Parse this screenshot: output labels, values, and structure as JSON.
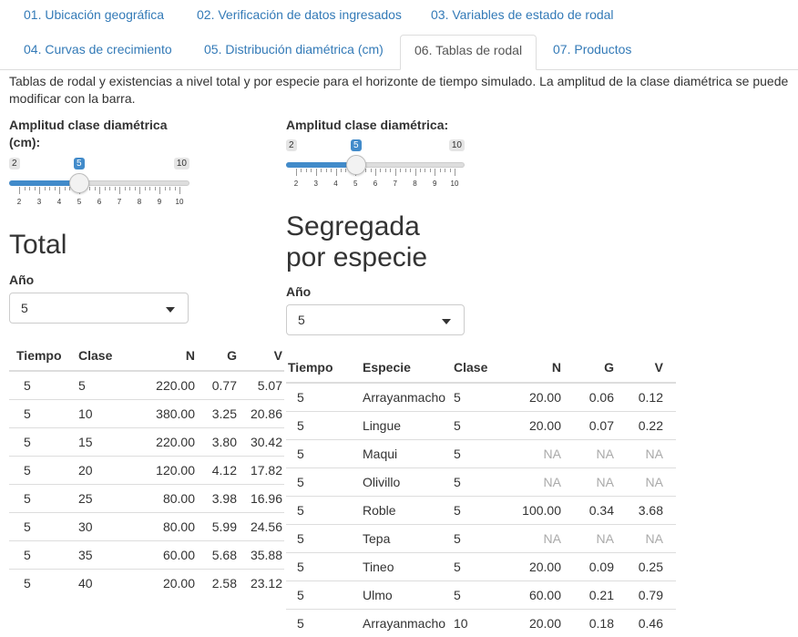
{
  "tabs_row1": [
    "01. Ubicación geográfica",
    "02. Verificación de datos ingresados",
    "03. Variables de estado de rodal"
  ],
  "tabs_row2": [
    "04. Curvas de crecimiento",
    "05. Distribución diamétrica (cm)",
    "06. Tablas de rodal",
    "07. Productos"
  ],
  "active_tab": "06. Tablas de rodal",
  "description": "Tablas de rodal y existencias a nivel total y por especie para el horizonte de tiempo simulado. La amplitud de la clase diamétrica se puede modificar con la barra.",
  "slider_left": {
    "label_line1": "Amplitud clase diamétrica",
    "label_line2": "(cm):",
    "min": "2",
    "max": "10",
    "value": "5",
    "ticks": [
      "2",
      "3",
      "4",
      "5",
      "6",
      "7",
      "8",
      "9",
      "10"
    ]
  },
  "slider_right": {
    "label": "Amplitud clase diamétrica:",
    "min": "2",
    "max": "10",
    "value": "5",
    "ticks": [
      "2",
      "3",
      "4",
      "5",
      "6",
      "7",
      "8",
      "9",
      "10"
    ]
  },
  "total": {
    "heading": "Total",
    "year_label": "Año",
    "year_value": "5",
    "columns": [
      "Tiempo",
      "Clase",
      "N",
      "G",
      "V"
    ],
    "rows": [
      [
        "5",
        "5",
        "220.00",
        "0.77",
        "5.07"
      ],
      [
        "5",
        "10",
        "380.00",
        "3.25",
        "20.86"
      ],
      [
        "5",
        "15",
        "220.00",
        "3.80",
        "30.42"
      ],
      [
        "5",
        "20",
        "120.00",
        "4.12",
        "17.82"
      ],
      [
        "5",
        "25",
        "80.00",
        "3.98",
        "16.96"
      ],
      [
        "5",
        "30",
        "80.00",
        "5.99",
        "24.56"
      ],
      [
        "5",
        "35",
        "60.00",
        "5.68",
        "35.88"
      ],
      [
        "5",
        "40",
        "20.00",
        "2.58",
        "23.12"
      ]
    ]
  },
  "species": {
    "heading_line1": "Segregada",
    "heading_line2": "por especie",
    "year_label": "Año",
    "year_value": "5",
    "columns": [
      "Tiempo",
      "Especie",
      "Clase",
      "N",
      "G",
      "V"
    ],
    "rows": [
      [
        "5",
        "Arrayanmacho",
        "5",
        "20.00",
        "0.06",
        "0.12"
      ],
      [
        "5",
        "Lingue",
        "5",
        "20.00",
        "0.07",
        "0.22"
      ],
      [
        "5",
        "Maqui",
        "5",
        "NA",
        "NA",
        "NA"
      ],
      [
        "5",
        "Olivillo",
        "5",
        "NA",
        "NA",
        "NA"
      ],
      [
        "5",
        "Roble",
        "5",
        "100.00",
        "0.34",
        "3.68"
      ],
      [
        "5",
        "Tepa",
        "5",
        "NA",
        "NA",
        "NA"
      ],
      [
        "5",
        "Tineo",
        "5",
        "20.00",
        "0.09",
        "0.25"
      ],
      [
        "5",
        "Ulmo",
        "5",
        "60.00",
        "0.21",
        "0.79"
      ],
      [
        "5",
        "Arrayanmacho",
        "10",
        "20.00",
        "0.18",
        "0.46"
      ]
    ]
  },
  "colors": {
    "link": "#337ab7",
    "slider_accent": "#428bca"
  }
}
